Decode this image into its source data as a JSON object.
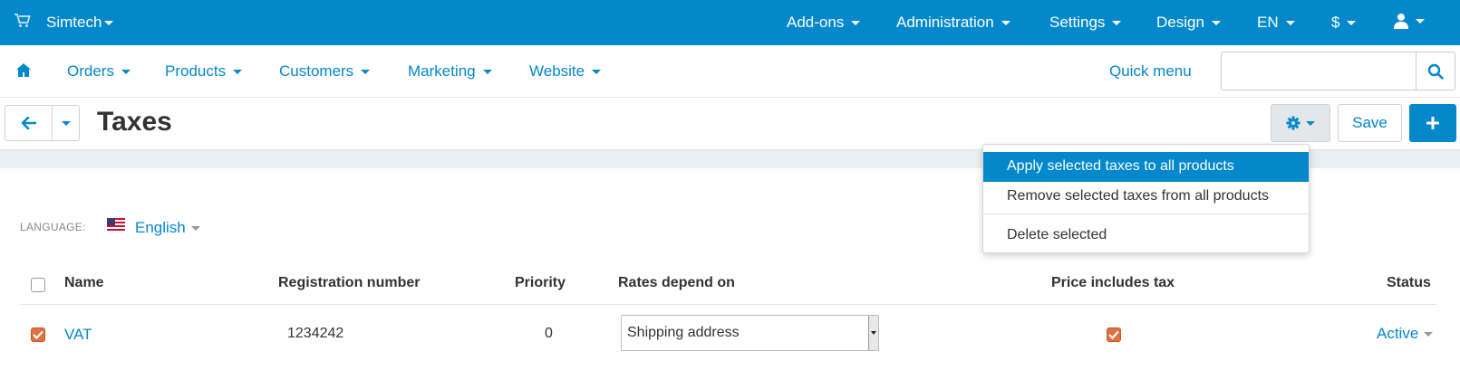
{
  "topbar": {
    "store_name": "Simtech",
    "menus": [
      "Add-ons",
      "Administration",
      "Settings",
      "Design",
      "EN",
      "$"
    ]
  },
  "subnav": {
    "items": [
      "Orders",
      "Products",
      "Customers",
      "Marketing",
      "Website"
    ],
    "quick_menu": "Quick menu",
    "search_placeholder": ""
  },
  "page": {
    "title": "Taxes",
    "save_label": "Save"
  },
  "actions_menu": {
    "items": [
      "Apply selected taxes to all products",
      "Remove selected taxes from all products",
      "Delete selected"
    ]
  },
  "language": {
    "label": "LANGUAGE:",
    "value": "English"
  },
  "table": {
    "headers": [
      "Name",
      "Registration number",
      "Priority",
      "Rates depend on",
      "Price includes tax",
      "Status"
    ],
    "rows": [
      {
        "name": "VAT",
        "registration_number": "1234242",
        "priority": "0",
        "rates_depend_on": "Shipping address",
        "price_includes_tax": true,
        "status": "Active",
        "selected": true
      }
    ]
  },
  "colors": {
    "brand": "#0388cc",
    "checkbox": "#e07040"
  }
}
